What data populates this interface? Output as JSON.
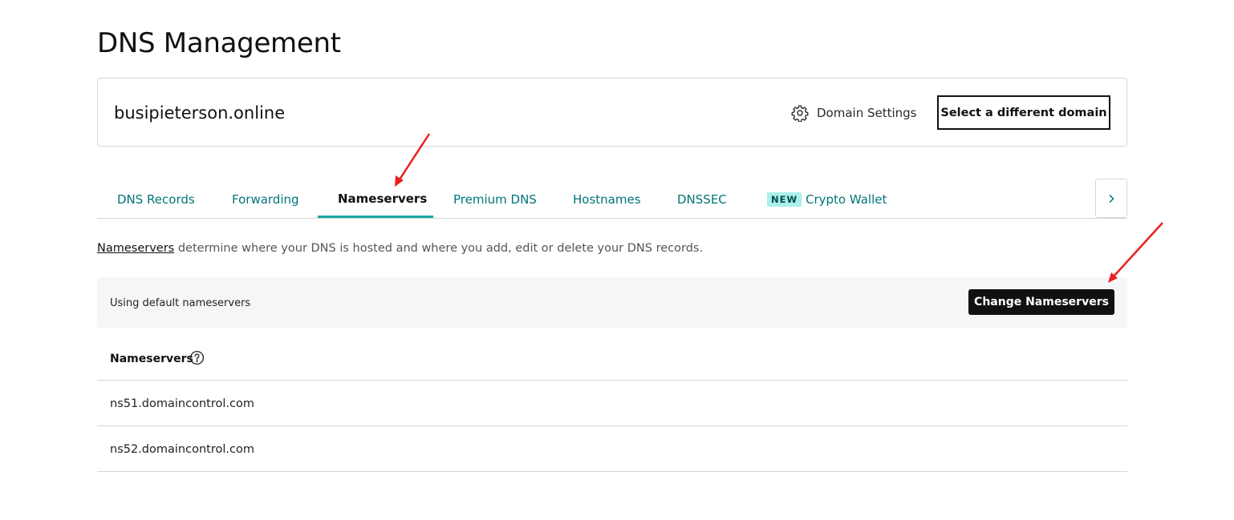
{
  "page": {
    "title": "DNS Management"
  },
  "domain_card": {
    "domain_name": "busipieterson.online",
    "settings_label": "Domain Settings",
    "select_button_label": "Select a different domain"
  },
  "tabs": {
    "items": [
      {
        "label": "DNS Records",
        "active": false
      },
      {
        "label": "Forwarding",
        "active": false
      },
      {
        "label": "Nameservers",
        "active": true
      },
      {
        "label": "Premium DNS",
        "active": false
      },
      {
        "label": "Hostnames",
        "active": false
      },
      {
        "label": "DNSSEC",
        "active": false
      },
      {
        "label": "Crypto Wallet",
        "active": false,
        "badge": "NEW"
      }
    ],
    "scroll_icon": "chevron-right-icon"
  },
  "intro": {
    "link_text": "Nameservers",
    "text": " determine where your DNS is hosted and where you add, edit or delete your DNS records."
  },
  "banner": {
    "status_text": "Using default nameservers",
    "button_label": "Change Nameservers"
  },
  "nameservers": {
    "header": "Nameservers",
    "help_icon": "question-circle-icon",
    "rows": [
      "ns51.domaincontrol.com",
      "ns52.domaincontrol.com"
    ]
  },
  "annotations": {
    "arrow_color": "#e8201f"
  },
  "colors": {
    "tab_link": "#00757a",
    "tab_underline": "#1ba8a3",
    "badge_bg": "#aaf0eb"
  }
}
